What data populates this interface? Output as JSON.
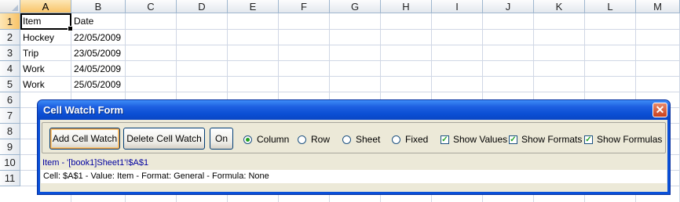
{
  "columns": [
    "A",
    "B",
    "C",
    "D",
    "E",
    "F",
    "G",
    "H",
    "I",
    "J",
    "K",
    "L",
    "M"
  ],
  "rows": [
    "1",
    "2",
    "3",
    "4",
    "5",
    "6",
    "7",
    "8",
    "9",
    "10",
    "11"
  ],
  "cells": [
    {
      "col": "A",
      "row": "1",
      "value": "Item"
    },
    {
      "col": "B",
      "row": "1",
      "value": "Date"
    },
    {
      "col": "A",
      "row": "2",
      "value": "Hockey"
    },
    {
      "col": "B",
      "row": "2",
      "value": "22/05/2009"
    },
    {
      "col": "A",
      "row": "3",
      "value": "Trip"
    },
    {
      "col": "B",
      "row": "3",
      "value": "23/05/2009"
    },
    {
      "col": "A",
      "row": "4",
      "value": "Work"
    },
    {
      "col": "B",
      "row": "4",
      "value": "24/05/2009"
    },
    {
      "col": "A",
      "row": "5",
      "value": "Work"
    },
    {
      "col": "B",
      "row": "5",
      "value": "25/05/2009"
    }
  ],
  "selected_cell": {
    "col": "A",
    "row": "1"
  },
  "form": {
    "title": "Cell Watch Form",
    "close_glyph": "✕",
    "add_button": "Add Cell Watch",
    "delete_button": "Delete Cell Watch",
    "on_button": "On",
    "radios": [
      {
        "label": "Column",
        "checked": true
      },
      {
        "label": "Row",
        "checked": false
      },
      {
        "label": "Sheet",
        "checked": false
      },
      {
        "label": "Fixed",
        "checked": false
      }
    ],
    "checkboxes": [
      {
        "label": "Show Values",
        "checked": true
      },
      {
        "label": "Show Formats",
        "checked": true
      },
      {
        "label": "Show Formulas",
        "checked": true
      }
    ],
    "watch_header": "Item - '[book1]Sheet1'!$A$1",
    "watch_line": "Cell: $A$1 - Value: Item  -  Format: General  -  Formula: None"
  },
  "colors": {
    "title_blue": "#0a50d8",
    "grid": "#d0d7e5",
    "header_selected": "#f8c368",
    "link_blue": "#0000a0"
  }
}
